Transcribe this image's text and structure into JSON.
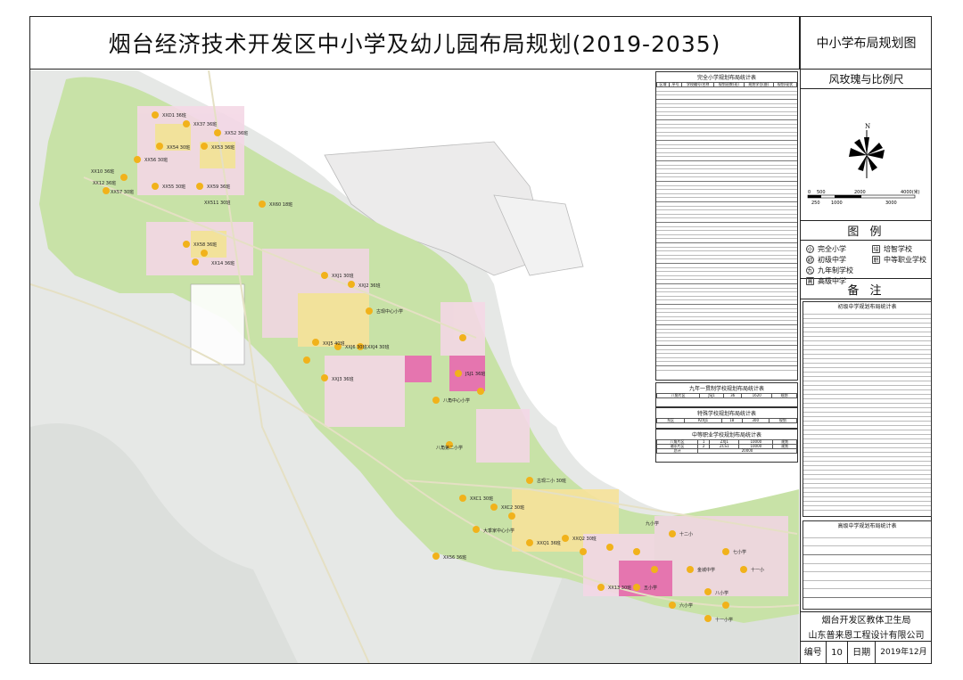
{
  "title": "烟台经济技术开发区中小学及幼儿园布局规划(2019-2035)",
  "side": {
    "map_name": "中小学布局规划图",
    "rose_title": "风玫瑰与比例尺",
    "north": "N",
    "scale_top": [
      "0",
      "500",
      "2000",
      "4000(米)"
    ],
    "scale_bottom": [
      "250",
      "1000",
      "3000"
    ],
    "legend_title": "图  例",
    "legend": [
      {
        "sym": "小",
        "label": "完全小学"
      },
      {
        "sym": "培",
        "label": "培智学校"
      },
      {
        "sym": "初",
        "label": "初级中学"
      },
      {
        "sym": "职",
        "label": "中等职业学校"
      },
      {
        "sym": "九",
        "label": "九年制学校"
      },
      {
        "sym": "高",
        "label": "高级中学"
      }
    ],
    "notes_title": "备  注",
    "middle_table_caption": "初级中学规划布局统计表",
    "high_table_caption": "高级中学规划布局统计表",
    "org1": "烟台开发区教体卫生局",
    "org2": "山东普来恩工程设计有限公司",
    "num_label": "编号",
    "num_value": "10",
    "date_label": "日期",
    "date_value": "2019年12月"
  },
  "map_tables": {
    "primary_caption": "完全小学规划布局统计表",
    "nine_caption": "九年一贯制学校规划布局统计表",
    "special_caption": "特殊学校规划布局统计表",
    "vocational_caption": "中等职业学校规划布局统计表",
    "table_headers": [
      "区域",
      "序号",
      "学校编号/名称",
      "规划班数(班)",
      "规划学位(座)",
      "规划/现状"
    ],
    "nine_row": [
      "八角片区",
      "JSJ1",
      "36",
      "1620",
      "规划"
    ],
    "special_row": [
      "东区",
      "PZXJ1",
      "18",
      "300",
      "规划"
    ],
    "vocational_rows": [
      [
        "八角片区",
        "1",
        "ZXJ1",
        "10000",
        "规划"
      ],
      [
        "潮水片区",
        "2",
        "ZCS1",
        "10000",
        "规划"
      ]
    ],
    "vocational_total": [
      "总计",
      "20000"
    ]
  },
  "map_labels": [
    "XXD1 36班",
    "XX37 36班",
    "XX52 36班",
    "XX53 36班",
    "XX54 30班",
    "XX56 30班",
    "XX10 36班",
    "XX55 30班",
    "XX57 30班",
    "XX12 36班",
    "XX59 36班",
    "XX58 36班",
    "XX56 36班",
    "XX511 30班",
    "XX60 18班",
    "XX13 30班",
    "XX14 36班",
    "XXJ1 30班",
    "XXJ2 36班",
    "古现中心小学",
    "XXJ5 40班",
    "XXJ6 30班",
    "XXJ4 30班",
    "XXJ3 36班",
    "八角中心小学",
    "JSJ1 36班",
    "八角第二小学",
    "古现二小 30班",
    "XXC1 30班",
    "XXC2 30班",
    "大季家中心小学",
    "XXQ1 36班",
    "XXQ2 30班",
    "九小学",
    "十二小",
    "金城中学",
    "七小学",
    "十一小",
    "五小学",
    "六小学",
    "八小学",
    "十一小学"
  ]
}
